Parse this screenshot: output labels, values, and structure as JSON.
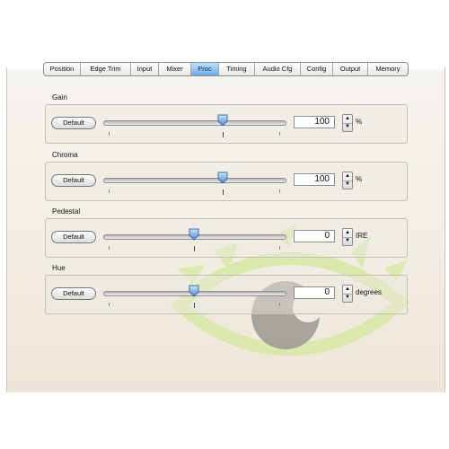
{
  "tabs": [
    {
      "label": "Position",
      "active": false
    },
    {
      "label": "Edge Trim",
      "active": false
    },
    {
      "label": "Input",
      "active": false
    },
    {
      "label": "Mixer",
      "active": false
    },
    {
      "label": "Proc",
      "active": true
    },
    {
      "label": "Timing",
      "active": false
    },
    {
      "label": "Audio Cfg",
      "active": false
    },
    {
      "label": "Config",
      "active": false
    },
    {
      "label": "Output",
      "active": false
    },
    {
      "label": "Memory",
      "active": false
    }
  ],
  "controls": [
    {
      "label": "Gain",
      "default_label": "Default",
      "value": "100",
      "unit": "%",
      "slider_fraction": 0.66
    },
    {
      "label": "Chroma",
      "default_label": "Default",
      "value": "100",
      "unit": "%",
      "slider_fraction": 0.66
    },
    {
      "label": "Pedestal",
      "default_label": "Default",
      "value": "0",
      "unit": "IRE",
      "slider_fraction": 0.5
    },
    {
      "label": "Hue",
      "default_label": "Default",
      "value": "0",
      "unit": "degrees",
      "slider_fraction": 0.5
    }
  ],
  "icons": {
    "stepper_up": "▲",
    "stepper_down": "▼",
    "watermark": "eye-logo-watermark-icon"
  },
  "colors": {
    "active_tab": "#6fa9e6",
    "watermark_green": "#d7e8a6",
    "watermark_gray": "#9b9893",
    "slider_thumb": "#5f98d6"
  }
}
